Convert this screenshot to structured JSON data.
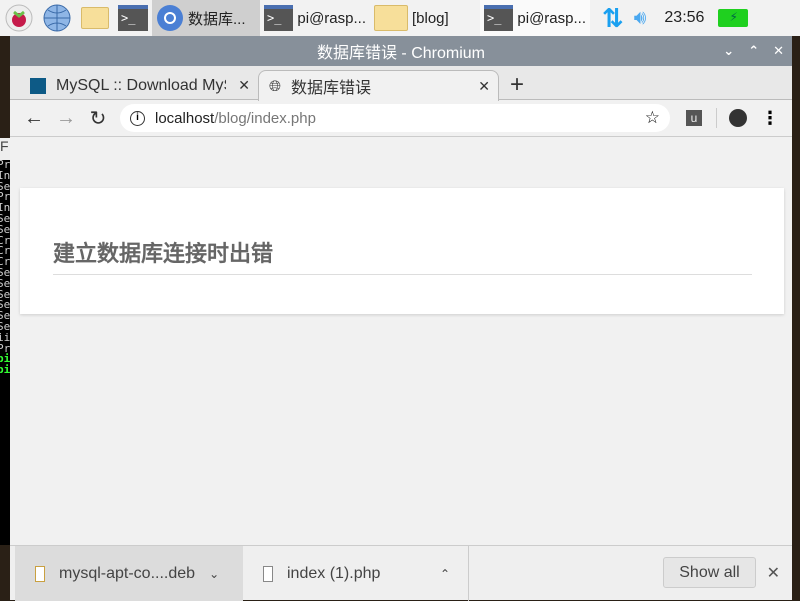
{
  "taskbar": {
    "tasks": [
      {
        "label": "数据库..."
      },
      {
        "label": "pi@rasp..."
      },
      {
        "label": "[blog]"
      },
      {
        "label": "pi@rasp..."
      }
    ],
    "clock": "23:56"
  },
  "terminal": {
    "top_label": "F",
    "lines": [
      "Pr",
      "In",
      "Se",
      "Pr",
      "In",
      "Se",
      "Se",
      "",
      "Cr",
      "",
      "Cr",
      "",
      "Cr",
      "Se",
      "Se",
      "Se",
      "Se",
      "Se",
      "Se",
      "ii",
      "Pr",
      "pi",
      "",
      "pi"
    ]
  },
  "window": {
    "title": "数据库错误 - Chromium"
  },
  "tabs": [
    {
      "label": "MySQL :: Download MyS"
    },
    {
      "label": "数据库错误"
    }
  ],
  "address": {
    "host": "localhost",
    "path": "/blog/index.php"
  },
  "extension_label": "u",
  "page": {
    "heading": "建立数据库连接时出错"
  },
  "downloads": {
    "items": [
      {
        "name": "mysql-apt-co....deb"
      },
      {
        "name": "index (1).php"
      }
    ],
    "show_all": "Show all"
  }
}
